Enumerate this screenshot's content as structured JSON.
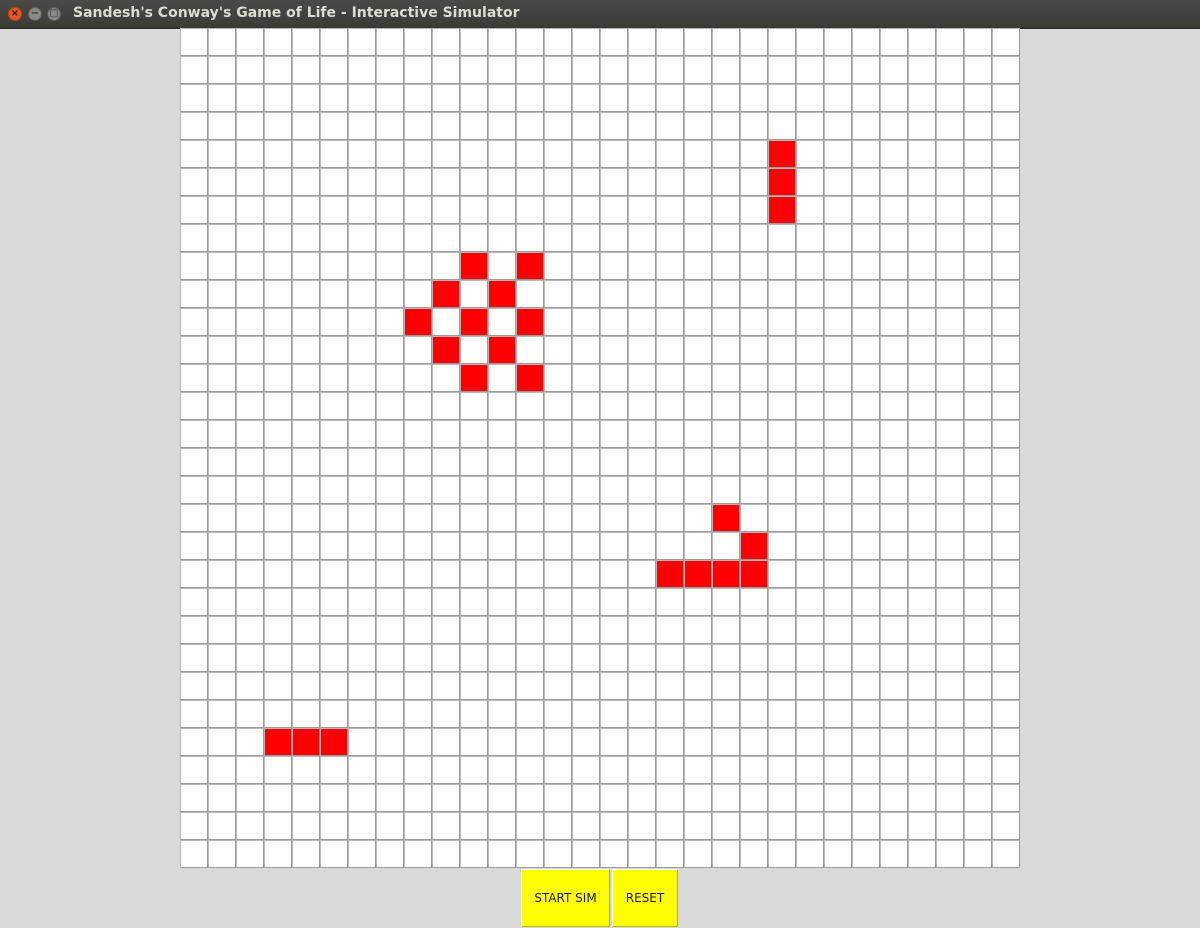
{
  "window": {
    "title": "Sandesh's Conway's Game of Life - Interactive Simulator",
    "close_glyph": "×",
    "minimize_glyph": "−",
    "maximize_glyph": "□"
  },
  "grid": {
    "rows": 30,
    "cols": 30,
    "alive_color": "#ff0000",
    "dead_color": "#ffffff",
    "alive_cells": [
      [
        4,
        21
      ],
      [
        5,
        21
      ],
      [
        6,
        21
      ],
      [
        8,
        10
      ],
      [
        8,
        12
      ],
      [
        9,
        9
      ],
      [
        9,
        11
      ],
      [
        10,
        8
      ],
      [
        10,
        10
      ],
      [
        10,
        12
      ],
      [
        11,
        9
      ],
      [
        11,
        11
      ],
      [
        12,
        10
      ],
      [
        12,
        12
      ],
      [
        17,
        19
      ],
      [
        18,
        20
      ],
      [
        19,
        17
      ],
      [
        19,
        18
      ],
      [
        19,
        19
      ],
      [
        19,
        20
      ],
      [
        25,
        3
      ],
      [
        25,
        4
      ],
      [
        25,
        5
      ]
    ]
  },
  "controls": {
    "start_label": "START SIM",
    "reset_label": "RESET",
    "button_color": "#ffff00"
  }
}
